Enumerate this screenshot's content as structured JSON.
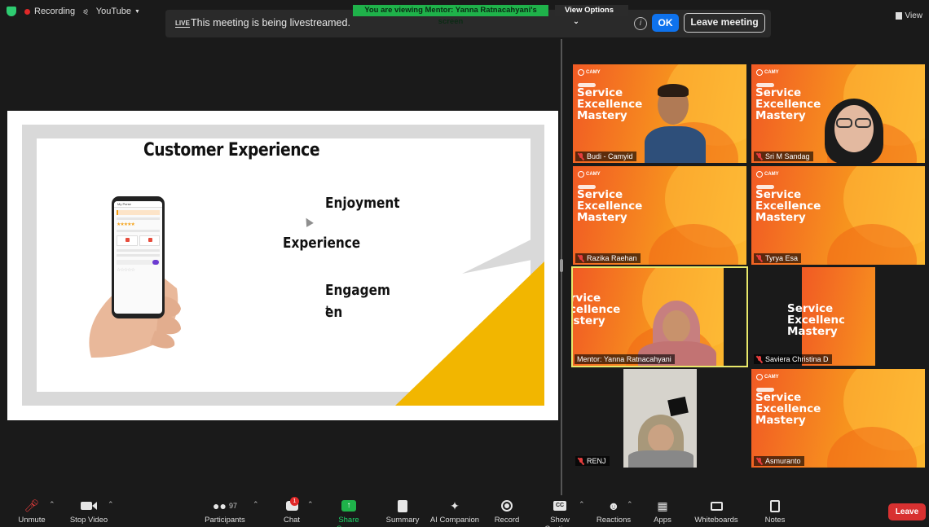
{
  "top": {
    "recording_label": "Recording",
    "youtube_label": "YouTube",
    "viewing_banner": "You are viewing Mentor: Yanna Ratnacahyani's screen",
    "view_options_label": "View Options",
    "live_badge": "LIVE",
    "live_message": "This meeting is being livestreamed.",
    "ok_label": "OK",
    "leave_meeting_label": "Leave meeting",
    "view_label": "View"
  },
  "slide": {
    "title": "Customer Experience",
    "word_1": "Enjoyment",
    "word_2": "Experience",
    "word_3": "Engagemen",
    "word_3_tail": "t",
    "phone_header": "My Purse",
    "accent_color": "#f2b600"
  },
  "gallery": {
    "slide_title": "Service Excellence Mastery",
    "brand": "CAMY",
    "participants": [
      {
        "name": "Budi - Camyid"
      },
      {
        "name": "Sri M Sandag"
      },
      {
        "name": "Razika Raehan"
      },
      {
        "name": "Tyrya Esa"
      },
      {
        "name": "Mentor: Yanna Ratnacahyani"
      },
      {
        "name": "Saviera Christina D"
      },
      {
        "name": "RENJ"
      },
      {
        "name": "Asmuranto"
      }
    ]
  },
  "toolbar": {
    "unmute": "Unmute",
    "stop_video": "Stop Video",
    "participants": "Participants",
    "participants_count": "97",
    "chat": "Chat",
    "chat_badge": "1",
    "share_screen": "Share Screen",
    "summary": "Summary",
    "ai_companion": "AI Companion",
    "record": "Record",
    "show_captions": "Show Captions",
    "reactions": "Reactions",
    "apps": "Apps",
    "whiteboards": "Whiteboards",
    "notes": "Notes",
    "leave": "Leave"
  }
}
